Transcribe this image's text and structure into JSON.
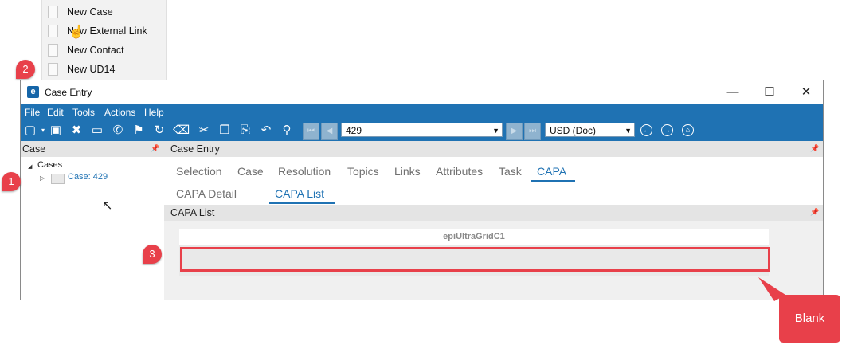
{
  "context_menu": {
    "items": [
      "New Case",
      "New External Link",
      "New Contact",
      "New UD14"
    ]
  },
  "window": {
    "title": "Case Entry",
    "logo_letter": "e",
    "controls": {
      "minimize": "—",
      "maximize": "☐",
      "close": "✕"
    }
  },
  "menubar": [
    "File",
    "Edit",
    "Tools",
    "Actions",
    "Help"
  ],
  "toolbar": {
    "record_combo": "429",
    "currency_combo": "USD (Doc)"
  },
  "left_pane": {
    "header": "Case",
    "tree_root": "Cases",
    "tree_child": "Case: 429"
  },
  "right_pane": {
    "header": "Case Entry",
    "tabs": [
      "Selection",
      "Case",
      "Resolution",
      "Topics",
      "Links",
      "Attributes",
      "Task",
      "CAPA"
    ],
    "active_tab": "CAPA",
    "sub_tabs": [
      "CAPA Detail",
      "CAPA List"
    ],
    "active_sub_tab": "CAPA List",
    "sub_header": "CAPA List",
    "grid_caption": "epiUltraGridC1"
  },
  "callouts": {
    "one": "1",
    "two": "2",
    "three": "3",
    "blank": "Blank"
  },
  "colors": {
    "accent": "#1f72b3",
    "callout": "#e8404a"
  }
}
